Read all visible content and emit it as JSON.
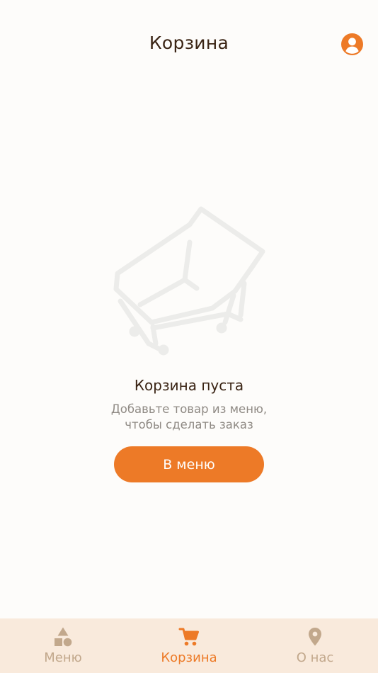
{
  "header": {
    "title": "Корзина",
    "profile_icon": "user-circle-icon"
  },
  "empty_state": {
    "illustration": "shopping-cart-outline",
    "title": "Корзина пуста",
    "subtitle_line1": "Добавьте товар из меню,",
    "subtitle_line2": "чтобы сделать заказ",
    "button_label": "В меню"
  },
  "bottom_nav": {
    "items": [
      {
        "label": "Меню",
        "icon": "shapes-icon",
        "active": false
      },
      {
        "label": "Корзина",
        "icon": "cart-icon",
        "active": true
      },
      {
        "label": "О нас",
        "icon": "location-pin-icon",
        "active": false
      }
    ]
  },
  "colors": {
    "accent": "#ed7a27",
    "background": "#fdfcfa",
    "nav_background": "#f9eadc",
    "title_text": "#3a2414",
    "muted_text": "#8f8a84",
    "nav_inactive": "#c2a88c"
  }
}
